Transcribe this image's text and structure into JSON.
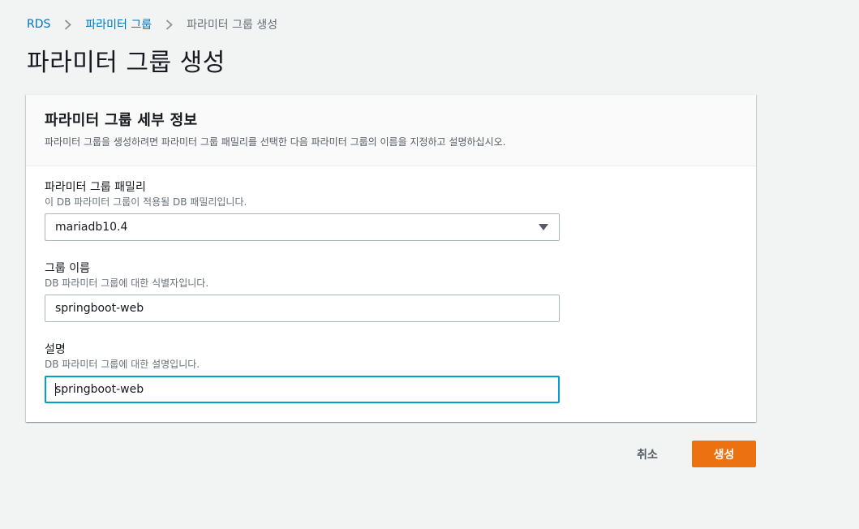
{
  "breadcrumb": {
    "items": [
      {
        "label": "RDS"
      },
      {
        "label": "파라미터 그룹"
      },
      {
        "label": "파라미터 그룹 생성"
      }
    ]
  },
  "page": {
    "title": "파라미터 그룹 생성"
  },
  "panel": {
    "title": "파라미터 그룹 세부 정보",
    "description": "파라미터 그룹을 생성하려면 파라미터 그룹 패밀리를 선택한 다음 파라미터 그룹의 이름을 지정하고 설명하십시오."
  },
  "fields": {
    "family": {
      "label": "파라미터 그룹 패밀리",
      "hint": "이 DB 파라미터 그룹이 적용될 DB 패밀리입니다.",
      "value": "mariadb10.4"
    },
    "group_name": {
      "label": "그룹 이름",
      "hint": "DB 파라미터 그룹에 대한 식별자입니다.",
      "value": "springboot-web"
    },
    "description": {
      "label": "설명",
      "hint": "DB 파라미터 그룹에 대한 설명입니다.",
      "value": "springboot-web"
    }
  },
  "actions": {
    "cancel_label": "취소",
    "create_label": "생성"
  },
  "colors": {
    "link": "#0073bb",
    "primary_button": "#ec7211",
    "focus_border": "#00a1c9",
    "background": "#f2f3f3"
  },
  "icons": {
    "breadcrumb_separator": "chevron-right-icon",
    "select_caret": "caret-down-icon"
  }
}
